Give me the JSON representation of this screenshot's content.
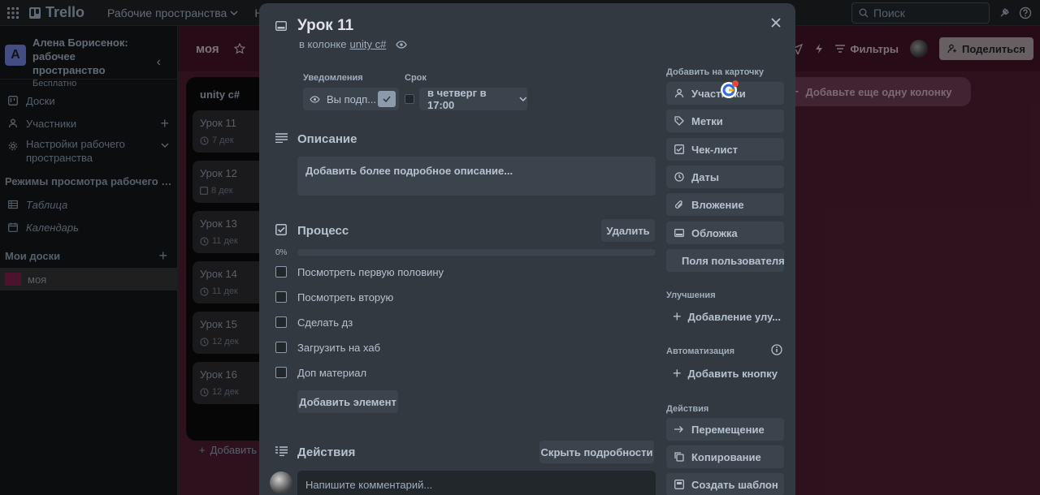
{
  "topbar": {
    "app_name": "Trello",
    "nav_workspaces": "Рабочие пространства",
    "nav_recent_partial": "Неда",
    "search_placeholder": "Поиск"
  },
  "sidebar": {
    "workspace_initial": "А",
    "workspace_name": "Алена Борисенок: рабочее пространство",
    "workspace_plan": "Бесплатно",
    "items": [
      {
        "label": "Доски"
      },
      {
        "label": "Участники"
      },
      {
        "label": "Настройки рабочего пространства"
      }
    ],
    "views_heading": "Режимы просмотра рабочего прос...",
    "views": [
      {
        "label": "Таблица"
      },
      {
        "label": "Календарь"
      }
    ],
    "boards_heading": "Мои доски",
    "boards": [
      {
        "label": "моя"
      }
    ]
  },
  "board": {
    "title": "моя",
    "filters_label": "Фильтры",
    "share_label": "Поделиться",
    "list_title": "unity c#",
    "cards": [
      {
        "title": "Урок 11",
        "date": "7 дек"
      },
      {
        "title": "Урок 12",
        "date": "8 дек"
      },
      {
        "title": "Урок 13",
        "date": "11 дек"
      },
      {
        "title": "Урок 14",
        "date": "11 дек"
      },
      {
        "title": "Урок 15",
        "date": "12 дек"
      },
      {
        "title": "Урок 16",
        "date": "12 дек"
      }
    ],
    "list_add_label": "Добавить",
    "add_column_label": "Добавьте еще одну колонку"
  },
  "card_modal": {
    "title": "Урок 11",
    "in_column_prefix": "в колонке",
    "column_name": "unity c#",
    "notifications_label": "Уведомления",
    "watching_label": "Вы подп...",
    "due_label": "Срок",
    "due_value": "в четверг в 17:00",
    "description_title": "Описание",
    "description_placeholder": "Добавить более подробное описание...",
    "checklist_title": "Процесс",
    "delete_label": "Удалить",
    "progress_text": "0%",
    "progress_fraction": 0,
    "checklist_items": [
      {
        "label": "Посмотреть первую половину",
        "checked": false
      },
      {
        "label": "Посмотреть вторую",
        "checked": false
      },
      {
        "label": "Сделать дз",
        "checked": false
      },
      {
        "label": "Загрузить на хаб",
        "checked": false
      },
      {
        "label": "Доп материал",
        "checked": false
      }
    ],
    "add_item_label": "Добавить элемент",
    "activity_title": "Действия",
    "hide_details_label": "Скрыть подробности",
    "comment_placeholder": "Напишите комментарий...",
    "add_to_card_heading": "Добавить на карточку",
    "add_to_card": [
      {
        "label": "Участники",
        "icon": "person-icon"
      },
      {
        "label": "Метки",
        "icon": "tag-icon"
      },
      {
        "label": "Чек-лист",
        "icon": "checkbox-icon"
      },
      {
        "label": "Даты",
        "icon": "clock-icon"
      },
      {
        "label": "Вложение",
        "icon": "paperclip-icon"
      },
      {
        "label": "Обложка",
        "icon": "cover-icon"
      },
      {
        "label": "Поля пользователя",
        "icon": "folder-icon"
      }
    ],
    "powerups_heading": "Улучшения",
    "powerups_add_label": "Добавление улу...",
    "automation_heading": "Автоматизация",
    "automation_add_label": "Добавить кнопку",
    "actions_heading": "Действия",
    "actions": [
      {
        "label": "Перемещение",
        "icon": "arrow-right-icon"
      },
      {
        "label": "Копирование",
        "icon": "copy-icon"
      },
      {
        "label": "Создать шаблон",
        "icon": "template-icon"
      }
    ]
  },
  "colors": {
    "board_bg": "#4a1e31",
    "modal_bg": "#323940",
    "progress": "#4bce97"
  }
}
